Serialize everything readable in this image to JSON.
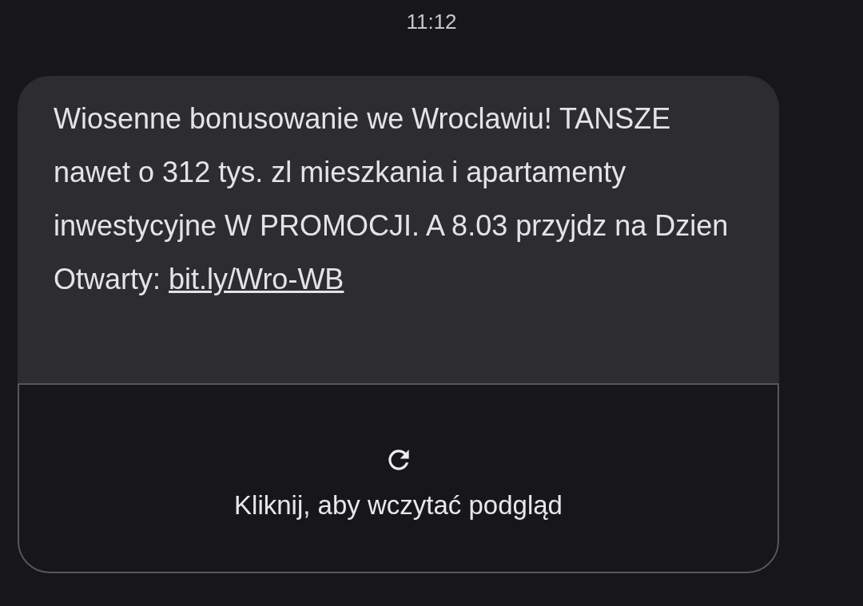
{
  "timestamp": "11:12",
  "message": {
    "text": "Wiosenne bonusowanie we Wroclawiu! TANSZE nawet o 312 tys. zl mieszkania i apartamenty inwestycyjne W PROMOCJI. A 8.03 przyjdz na Dzien Otwarty:",
    "link": "bit.ly/Wro-WB"
  },
  "preview": {
    "label": "Kliknij, aby wczytać podgląd"
  }
}
